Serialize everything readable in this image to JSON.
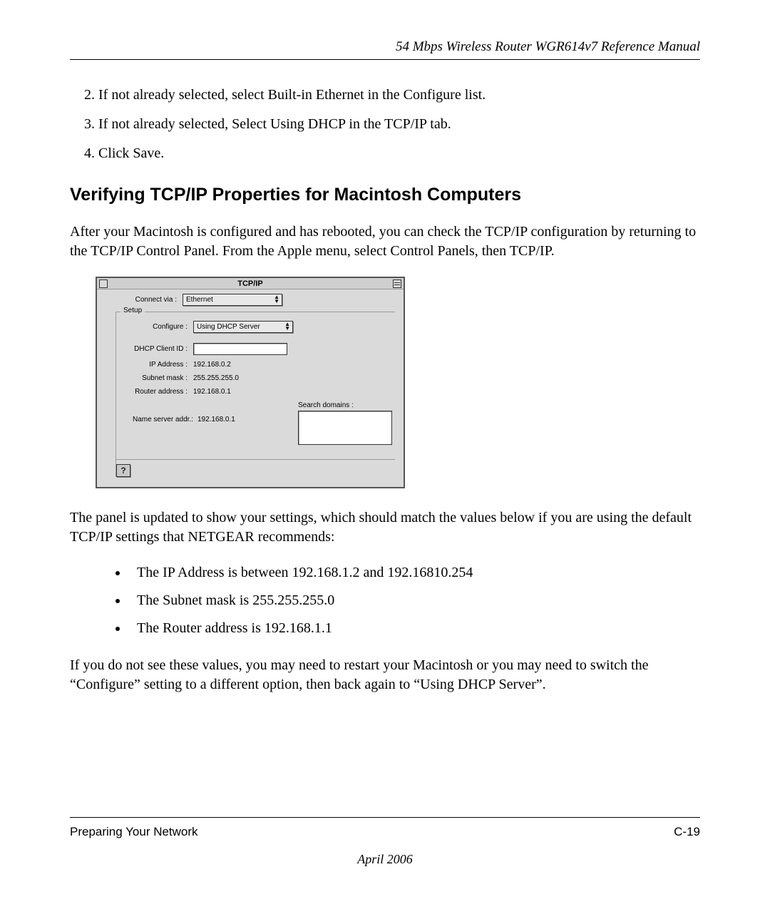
{
  "header": "54 Mbps Wireless Router WGR614v7 Reference Manual",
  "steps": [
    "If not already selected, select Built-in Ethernet in the Configure list.",
    "If not already selected, Select Using DHCP in the TCP/IP tab.",
    "Click Save."
  ],
  "section_heading": "Verifying TCP/IP Properties for Macintosh Computers",
  "intro_para": "After your Macintosh is configured and has rebooted, you can check the TCP/IP configuration by returning to the TCP/IP Control Panel. From the Apple menu, select Control Panels, then TCP/IP.",
  "tcpip": {
    "title": "TCP/IP",
    "connect_via_label": "Connect via :",
    "connect_via_value": "Ethernet",
    "setup_legend": "Setup",
    "configure_label": "Configure :",
    "configure_value": "Using DHCP Server",
    "dhcp_client_label": "DHCP Client ID :",
    "dhcp_client_value": "",
    "ip_label": "IP Address :",
    "ip_value": "192.168.0.2",
    "subnet_label": "Subnet mask :",
    "subnet_value": "255.255.255.0",
    "router_label": "Router address :",
    "router_value": "192.168.0.1",
    "search_domains_label": "Search domains :",
    "ns_label": "Name server addr.:",
    "ns_value": "192.168.0.1",
    "help_glyph": "?"
  },
  "after_panel": "The panel is updated to show your settings, which should match the values below if you are using the default TCP/IP settings that NETGEAR recommends:",
  "bullets": [
    "The IP Address is between 192.168.1.2 and 192.16810.254",
    "The Subnet mask is 255.255.255.0",
    "The Router address is 192.168.1.1"
  ],
  "closing_para": "If you do not see these values, you may need to restart your Macintosh or you may need to switch the “Configure” setting to a different option, then back again to “Using DHCP Server”.",
  "footer": {
    "left": "Preparing Your Network",
    "right": "C-19",
    "date": "April 2006"
  }
}
